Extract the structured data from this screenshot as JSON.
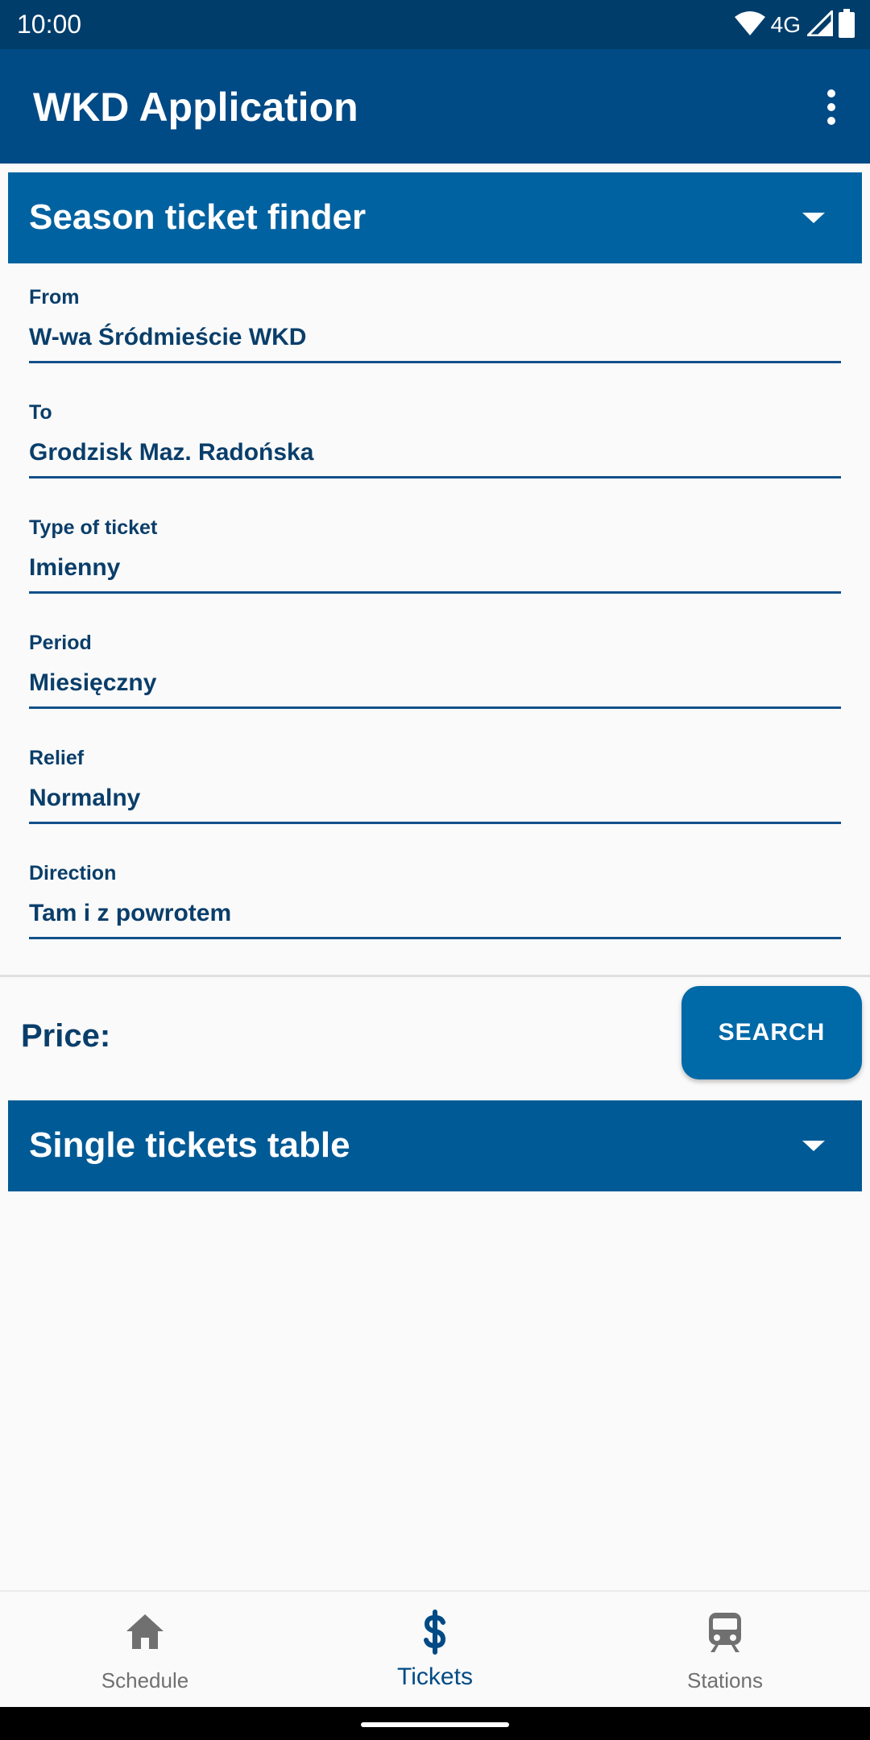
{
  "status_bar": {
    "time": "10:00",
    "network": "4G",
    "icons": [
      "wifi-icon",
      "signal-icon",
      "battery-icon"
    ]
  },
  "app_bar": {
    "title": "WKD Application",
    "menu_icon": "more-vert-icon"
  },
  "season_section": {
    "title": "Season ticket finder",
    "expand_icon": "chevron-down-icon",
    "fields": [
      {
        "label": "From",
        "value": "W-wa Śródmieście WKD"
      },
      {
        "label": "To",
        "value": "Grodzisk Maz. Radońska"
      },
      {
        "label": "Type of ticket",
        "value": "Imienny"
      },
      {
        "label": "Period",
        "value": "Miesięczny"
      },
      {
        "label": "Relief",
        "value": "Normalny"
      },
      {
        "label": "Direction",
        "value": "Tam i z powrotem"
      }
    ],
    "price_label": "Price:",
    "search_label": "SEARCH"
  },
  "single_section": {
    "title": "Single tickets table",
    "expand_icon": "chevron-down-icon"
  },
  "bottom_nav": {
    "selected": "Tickets",
    "items": [
      {
        "label": "Schedule",
        "icon": "home-icon"
      },
      {
        "label": "Tickets",
        "icon": "dollar-icon"
      },
      {
        "label": "Stations",
        "icon": "train-icon"
      }
    ]
  },
  "colors": {
    "status_bar": "#003d6b",
    "app_bar": "#004a85",
    "section_header": "#0062a0",
    "accent_text": "#0a3e6a",
    "search_button": "#0069a8",
    "inactive_nav": "#707070"
  }
}
